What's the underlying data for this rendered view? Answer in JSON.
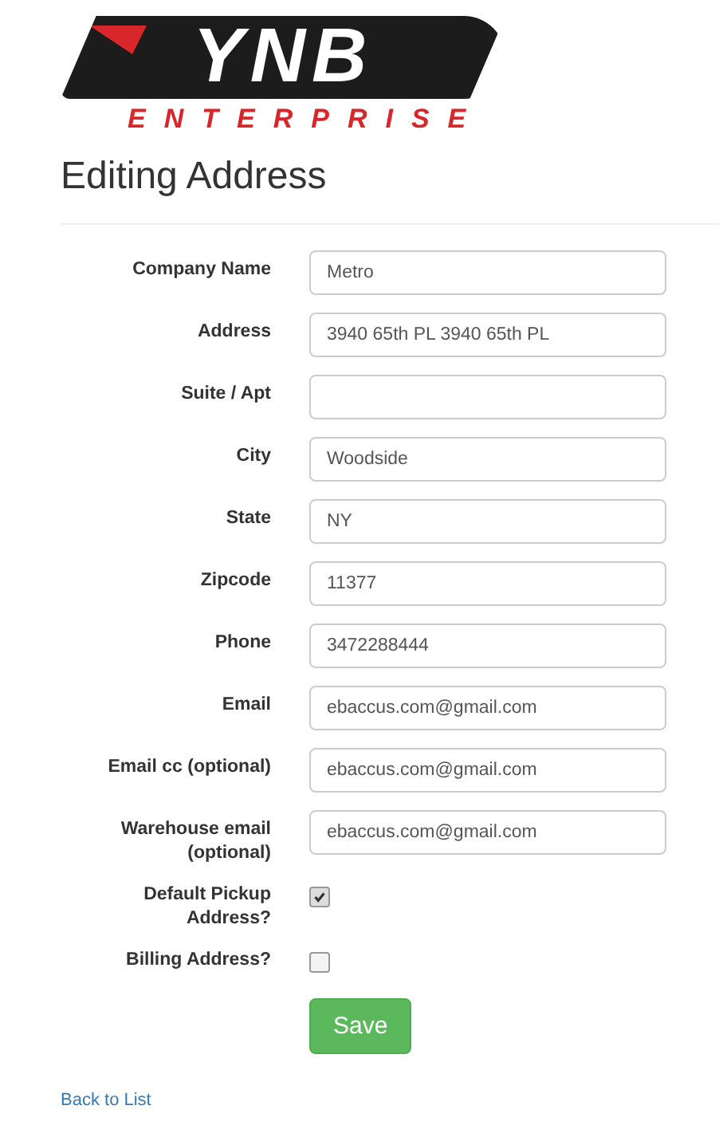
{
  "logo": {
    "mark": "YNB",
    "word": "ENTERPRISE"
  },
  "title": "Editing Address",
  "fields": [
    {
      "kind": "text",
      "label": "Company Name",
      "value": "Metro"
    },
    {
      "kind": "text",
      "label": "Address",
      "value": "3940 65th PL 3940 65th PL"
    },
    {
      "kind": "text",
      "label": "Suite / Apt"
    },
    {
      "kind": "text",
      "label": "City",
      "value": "Woodside"
    },
    {
      "kind": "text",
      "label": "State",
      "value": "NY"
    },
    {
      "kind": "text",
      "label": "Zipcode",
      "value": "11377"
    },
    {
      "kind": "text",
      "label": "Phone",
      "value": "3472288444"
    },
    {
      "kind": "text",
      "label": "Email",
      "value": "ebaccus.com@gmail.com"
    },
    {
      "kind": "text",
      "label": "Email cc (optional)",
      "value": "ebaccus.com@gmail.com"
    },
    {
      "kind": "text",
      "label": "Warehouse email (optional)",
      "value": "ebaccus.com@gmail.com"
    },
    {
      "kind": "checkbox",
      "label": "Default Pickup Address?",
      "checked": true
    },
    {
      "kind": "checkbox",
      "label": "Billing Address?",
      "checked": false
    }
  ],
  "save_button": "Save",
  "back_link": "Back to List"
}
